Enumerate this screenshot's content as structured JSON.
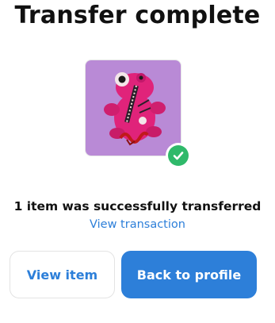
{
  "header": {
    "title": "Transfer complete"
  },
  "item": {
    "image_icon": "nft-frog-artwork",
    "status_icon": "check-circle-icon"
  },
  "result": {
    "message": "1 item was successfully transferred",
    "link_label": "View transaction"
  },
  "actions": {
    "view_item_label": "View item",
    "back_label": "Back to profile"
  },
  "colors": {
    "accent": "#2d7fd9",
    "success": "#2fb96a",
    "thumb_bg": "#b98ad6"
  }
}
